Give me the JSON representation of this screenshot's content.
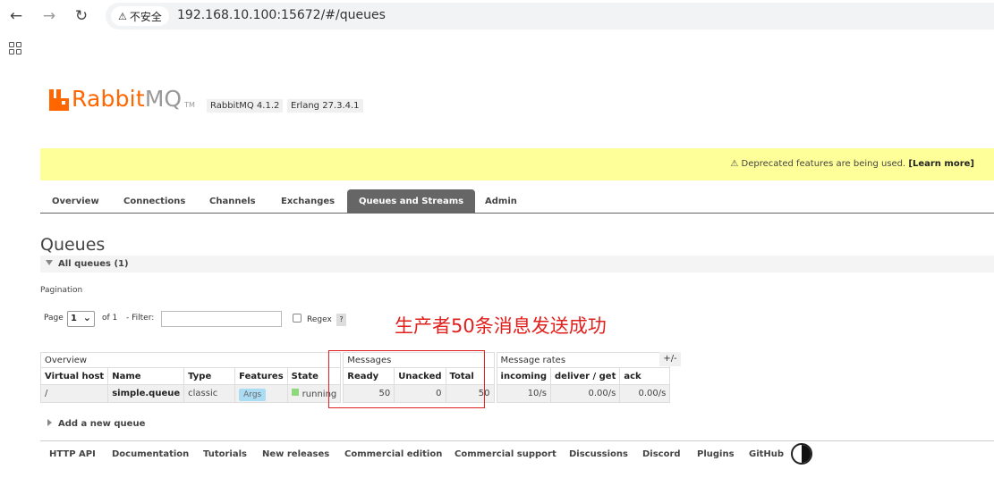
{
  "browser": {
    "back_icon": "←",
    "forward_icon": "→",
    "reload_icon": "↻",
    "security_warning": "不安全",
    "warning_icon": "⚠",
    "url": "192.168.10.100:15672/#/queues",
    "apps_icon": "apps-grid"
  },
  "header": {
    "logo_rabbit": "Rabbit",
    "logo_mq": "MQ",
    "logo_tm": "TM",
    "rabbitmq_version": "RabbitMQ 4.1.2",
    "erlang_version": "Erlang 27.3.4.1"
  },
  "banner": {
    "icon": "⚠",
    "text": "Deprecated features are being used.",
    "link": "[Learn more]",
    "color": "#ffff99"
  },
  "tabs": [
    {
      "label": "Overview"
    },
    {
      "label": "Connections"
    },
    {
      "label": "Channels"
    },
    {
      "label": "Exchanges"
    },
    {
      "label": "Queues and Streams",
      "active": true
    },
    {
      "label": "Admin"
    }
  ],
  "page": {
    "title": "Queues",
    "section_label": "All queues (1)",
    "pagination_label": "Pagination",
    "page_label": "Page",
    "page_value": "1",
    "page_chevron": "⌄",
    "of_label": "of 1",
    "filter_label": "- Filter:",
    "filter_value": "",
    "regex_label": "Regex",
    "help_label": "?",
    "annotation": "生产者50条消息发送成功",
    "annotation_color": "#e0201d",
    "plus_minus": "+/-",
    "add_queue": "Add a new queue"
  },
  "table": {
    "groups": {
      "overview": "Overview",
      "messages": "Messages",
      "rates": "Message rates"
    },
    "columns": {
      "vhost": "Virtual host",
      "name": "Name",
      "type": "Type",
      "features": "Features",
      "state": "State",
      "ready": "Ready",
      "unacked": "Unacked",
      "total": "Total",
      "incoming": "incoming",
      "deliver_get": "deliver / get",
      "ack": "ack"
    },
    "rows": [
      {
        "vhost": "/",
        "name": "simple.queue",
        "type": "classic",
        "features": "Args",
        "state": "running",
        "ready": "50",
        "unacked": "0",
        "total": "50",
        "incoming": "10/s",
        "deliver_get": "0.00/s",
        "ack": "0.00/s"
      }
    ]
  },
  "footer": {
    "links": [
      "HTTP API",
      "Documentation",
      "Tutorials",
      "New releases",
      "Commercial edition",
      "Commercial support",
      "Discussions",
      "Discord",
      "Plugins",
      "GitHub"
    ],
    "theme_icon": "theme-toggle"
  },
  "colors": {
    "brand": "#ff6600",
    "tab_active": "#666666",
    "running": "#8fd87c",
    "args_badge": "#aadcf3"
  }
}
